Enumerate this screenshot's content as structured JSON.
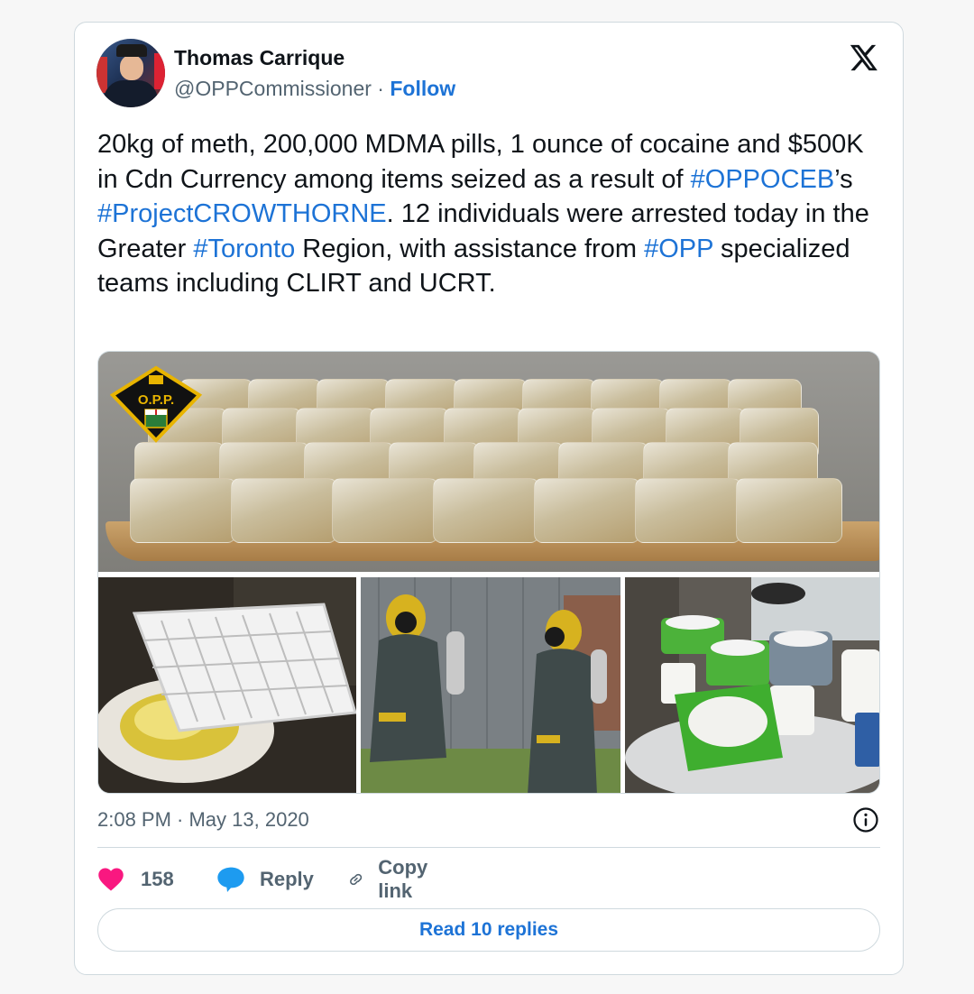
{
  "author": {
    "name": "Thomas Carrique",
    "handle": "@OPPCommissioner",
    "separator": "·",
    "follow_label": "Follow"
  },
  "tweet": {
    "segments": [
      {
        "text": "20kg of meth, 200,000 MDMA pills, 1 ounce of cocaine and $500K in Cdn Currency among items seized as a result of ",
        "link": false
      },
      {
        "text": "#OPPOCEB",
        "link": true
      },
      {
        "text": "’s ",
        "link": false
      },
      {
        "text": "#ProjectCROWTHORNE",
        "link": true
      },
      {
        "text": ". 12 individuals were arrested today in the Greater ",
        "link": false
      },
      {
        "text": "#Toronto",
        "link": true
      },
      {
        "text": " Region, with assistance from ",
        "link": false
      },
      {
        "text": "#OPP",
        "link": true
      },
      {
        "text": " specialized teams including CLIRT and UCRT.",
        "link": false
      }
    ]
  },
  "media": {
    "badge_text": "O.P.P."
  },
  "meta": {
    "timestamp": "2:08 PM · May 13, 2020"
  },
  "actions": {
    "like_count": "158",
    "reply_label": "Reply",
    "copy_label": "Copy link"
  },
  "read_replies_label": "Read 10 replies",
  "colors": {
    "link": "#1d73d6",
    "like": "#f91880",
    "reply_icon": "#1d9bf0",
    "muted": "#536471"
  },
  "icons": [
    "x-logo-icon",
    "heart-icon",
    "speech-bubble-icon",
    "link-icon",
    "info-icon"
  ]
}
